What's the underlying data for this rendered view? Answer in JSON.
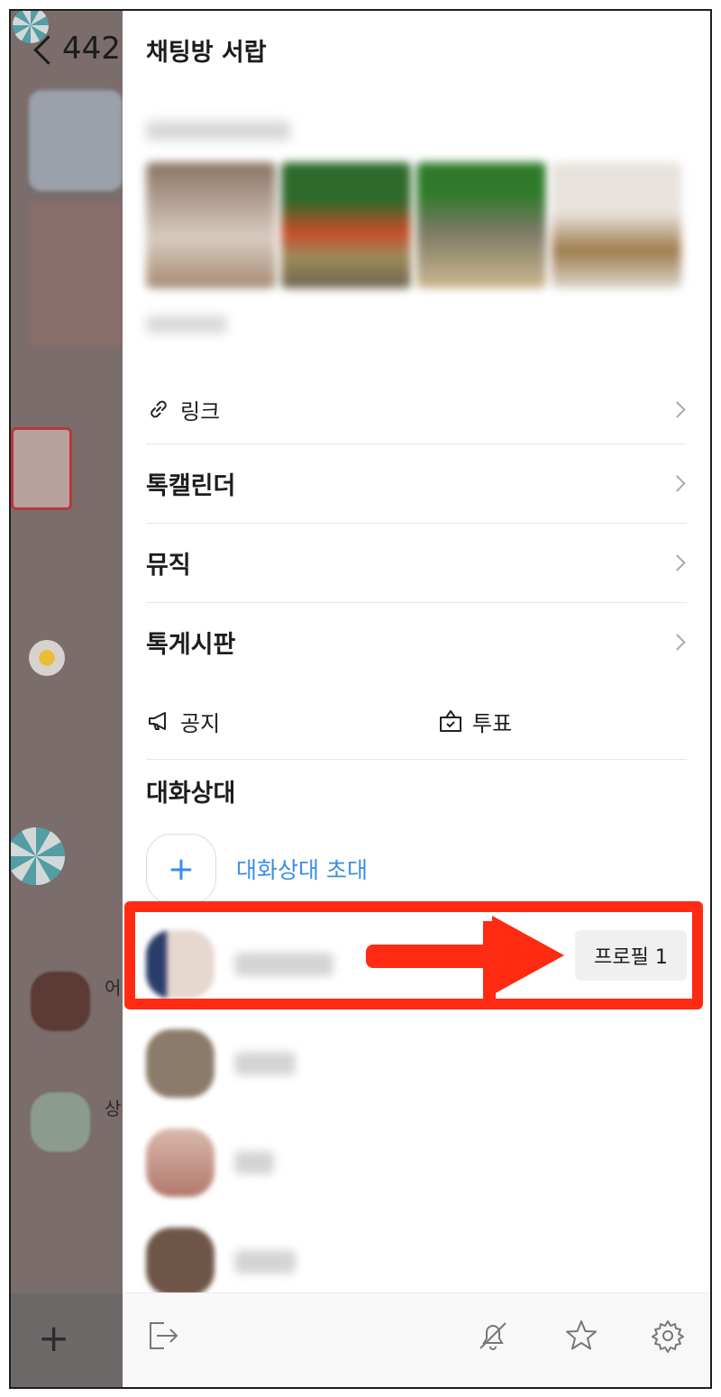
{
  "background": {
    "back_count": "442",
    "chat_preview_1": "어",
    "chat_preview_2": "상"
  },
  "drawer": {
    "title": "채팅방 서랍",
    "rows": {
      "link": "링크",
      "calendar": "톡캘린더",
      "music": "뮤직",
      "board": "톡게시판",
      "notice": "공지",
      "vote": "투표"
    },
    "members_section": {
      "title": "대화상대",
      "invite_label": "대화상대 초대",
      "profile_badge": "프로필 1"
    }
  },
  "colors": {
    "accent": "#3a8ee6",
    "annotation": "#ff2a12",
    "backdrop": "#7a6d6b"
  },
  "toolbar": {
    "icons": [
      "exit-icon",
      "bell-off-icon",
      "star-icon",
      "gear-icon"
    ]
  }
}
